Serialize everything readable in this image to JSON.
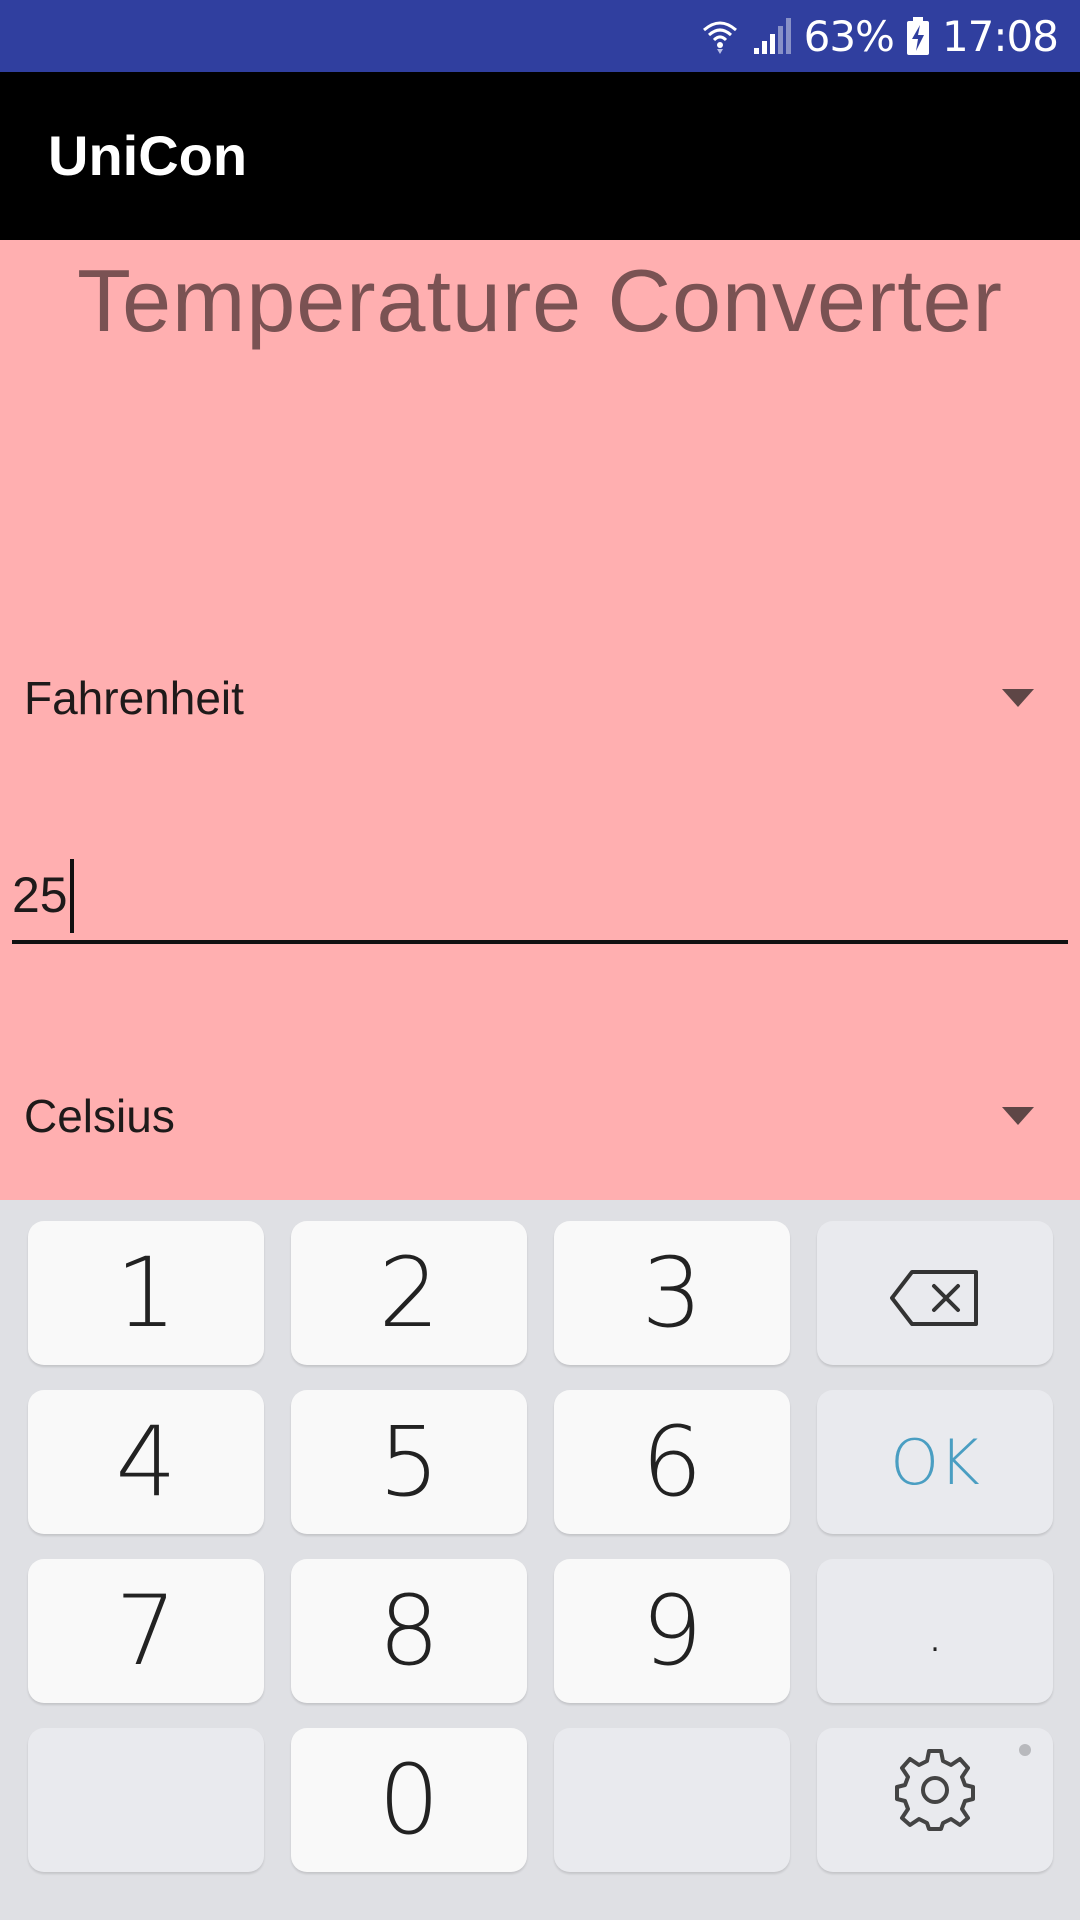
{
  "status_bar": {
    "battery_percent": "63%",
    "time": "17:08",
    "icons": [
      "wifi-icon",
      "signal-icon",
      "battery-charging-icon"
    ],
    "background_color": "#303f9f"
  },
  "app_bar": {
    "title": "UniCon",
    "background_color": "#000000"
  },
  "main": {
    "title": "Temperature Converter",
    "background_color": "#ffafb0",
    "from_unit": {
      "selected": "Fahrenheit",
      "icon": "dropdown-caret-icon"
    },
    "input": {
      "value": "25"
    },
    "to_unit": {
      "selected": "Celsius",
      "icon": "dropdown-caret-icon"
    }
  },
  "keyboard": {
    "keys": {
      "k1": "1",
      "k2": "2",
      "k3": "3",
      "k4": "4",
      "k5": "5",
      "k6": "6",
      "k7": "7",
      "k8": "8",
      "k9": "9",
      "k0": "0",
      "ok": "OK",
      "dot": "."
    },
    "backspace_icon": "backspace-icon",
    "settings_icon": "gear-icon",
    "ok_color": "#4a9ec2"
  }
}
